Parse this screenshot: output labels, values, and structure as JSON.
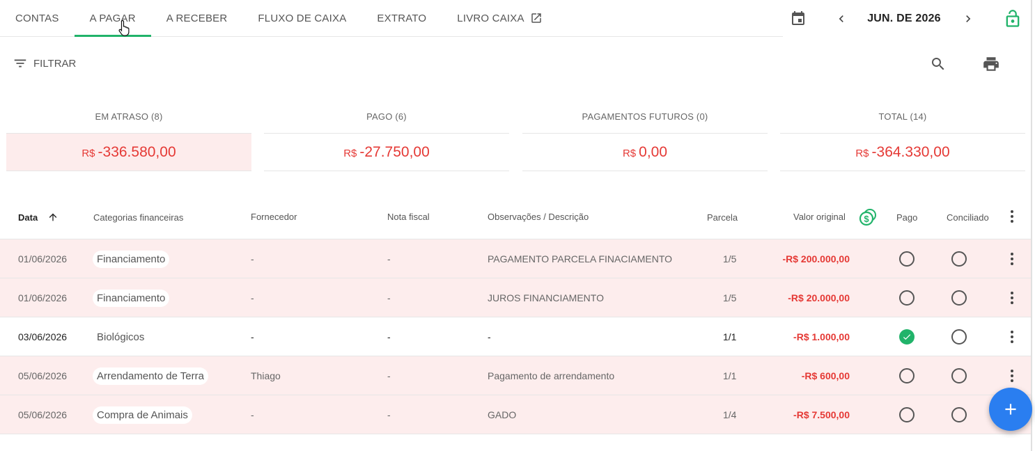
{
  "tabs": [
    {
      "label": "CONTAS"
    },
    {
      "label": "A PAGAR"
    },
    {
      "label": "A RECEBER"
    },
    {
      "label": "FLUXO DE CAIXA"
    },
    {
      "label": "EXTRATO"
    },
    {
      "label": "LIVRO CAIXA"
    }
  ],
  "active_tab": "A PAGAR",
  "period": {
    "label": "JUN. DE 2026"
  },
  "filter": {
    "label": "FILTRAR"
  },
  "summary": [
    {
      "title": "EM ATRASO (8)",
      "currency": "R$",
      "value": "-336.580,00"
    },
    {
      "title": "PAGO (6)",
      "currency": "R$",
      "value": "-27.750,00"
    },
    {
      "title": "PAGAMENTOS FUTUROS (0)",
      "currency": "R$",
      "value": "0,00"
    },
    {
      "title": "TOTAL (14)",
      "currency": "R$",
      "value": "-364.330,00"
    }
  ],
  "table": {
    "headers": {
      "data": "Data",
      "categoria": "Categorias financeiras",
      "fornecedor": "Fornecedor",
      "nota": "Nota fiscal",
      "obs": "Observações / Descrição",
      "parcela": "Parcela",
      "valor": "Valor original",
      "pago": "Pago",
      "conciliado": "Conciliado"
    },
    "rows": [
      {
        "data": "01/06/2026",
        "categoria": "Financiamento",
        "fornecedor": "-",
        "nota": "-",
        "obs": "PAGAMENTO PARCELA FINACIAMENTO",
        "parcela": "1/5",
        "valor": "-R$ 200.000,00",
        "pago": false,
        "conciliado": false,
        "status": "late"
      },
      {
        "data": "01/06/2026",
        "categoria": "Financiamento",
        "fornecedor": "-",
        "nota": "-",
        "obs": "JUROS FINANCIAMENTO",
        "parcela": "1/5",
        "valor": "-R$ 20.000,00",
        "pago": false,
        "conciliado": false,
        "status": "late"
      },
      {
        "data": "03/06/2026",
        "categoria": "Biológicos",
        "fornecedor": "-",
        "nota": "-",
        "obs": "-",
        "parcela": "1/1",
        "valor": "-R$ 1.000,00",
        "pago": true,
        "conciliado": false,
        "status": "ok"
      },
      {
        "data": "05/06/2026",
        "categoria": "Arrendamento de Terra",
        "fornecedor": "Thiago",
        "nota": "-",
        "obs": "Pagamento de arrendamento",
        "parcela": "1/1",
        "valor": "-R$ 600,00",
        "pago": false,
        "conciliado": false,
        "status": "late"
      },
      {
        "data": "05/06/2026",
        "categoria": "Compra de Animais",
        "fornecedor": "-",
        "nota": "-",
        "obs": "GADO",
        "parcela": "1/4",
        "valor": "-R$ 7.500,00",
        "pago": false,
        "conciliado": false,
        "status": "late"
      }
    ]
  },
  "colors": {
    "accent": "#21b36a",
    "negative": "#e53935",
    "late_bg": "#fdeded",
    "fab": "#2a7ef0"
  }
}
